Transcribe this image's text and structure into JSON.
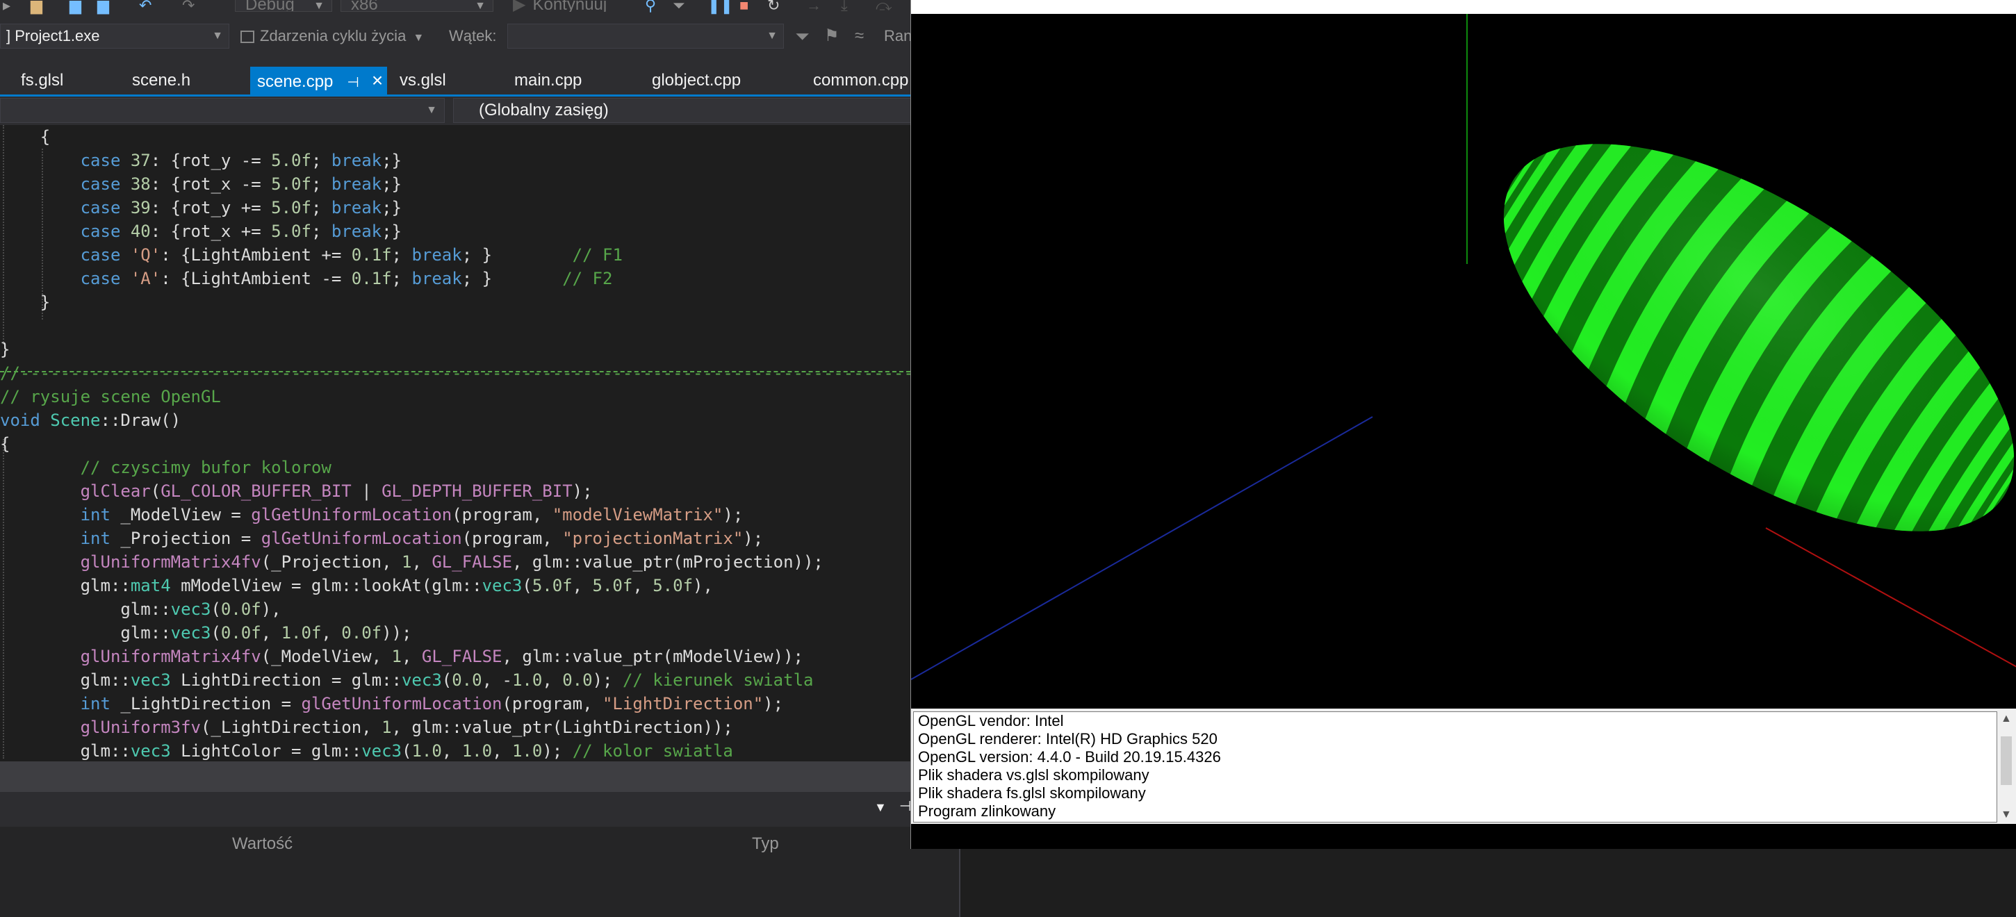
{
  "toolbar": {
    "configuration": "Debug",
    "platform": "x86",
    "continue_label": "Kontynuuj",
    "process": "] Project1.exe",
    "lifecycle_events": "Zdarzenia cyklu życia",
    "thread_label": "Wątek:",
    "thread_value": "",
    "ran_label": "Ran"
  },
  "tabs": [
    {
      "label": "fs.glsl"
    },
    {
      "label": "scene.h"
    },
    {
      "label": "scene.cpp",
      "active": true
    },
    {
      "label": "vs.glsl"
    },
    {
      "label": "main.cpp"
    },
    {
      "label": "globject.cpp"
    },
    {
      "label": "common.cpp"
    }
  ],
  "navbar": {
    "scope": "(Globalny zasięg)"
  },
  "code_lines": [
    "    {",
    "        case 37: {rot_y -= 5.0f; break;}",
    "        case 38: {rot_x -= 5.0f; break;}",
    "        case 39: {rot_y += 5.0f; break;}",
    "        case 40: {rot_x += 5.0f; break;}",
    "        case 'Q': {LightAmbient += 0.1f; break; }        // F1",
    "        case 'A': {LightAmbient -= 0.1f; break; }       // F2",
    "    }",
    "",
    "}",
    "//---------------------------------------------------------------------------------------------",
    "// rysuje scene OpenGL",
    "void Scene::Draw()",
    "{",
    "        // czyscimy bufor kolorow",
    "        glClear(GL_COLOR_BUFFER_BIT | GL_DEPTH_BUFFER_BIT);",
    "        int _ModelView = glGetUniformLocation(program, \"modelViewMatrix\");",
    "        int _Projection = glGetUniformLocation(program, \"projectionMatrix\");",
    "        glUniformMatrix4fv(_Projection, 1, GL_FALSE, glm::value_ptr(mProjection));",
    "        glm::mat4 mModelView = glm::lookAt(glm::vec3(5.0f, 5.0f, 5.0f),",
    "            glm::vec3(0.0f),",
    "            glm::vec3(0.0f, 1.0f, 0.0f));",
    "        glUniformMatrix4fv(_ModelView, 1, GL_FALSE, glm::value_ptr(mModelView));",
    "        glm::vec3 LightDirection = glm::vec3(0.0, -1.0, 0.0); // kierunek swiatla",
    "        int _LightDirection = glGetUniformLocation(program, \"LightDirection\");",
    "        glUniform3fv(_LightDirection, 1, glm::value_ptr(LightDirection));",
    "        glm::vec3 LightColor = glm::vec3(1.0, 1.0, 1.0); // kolor swiatla"
  ],
  "watch": {
    "col_value": "Wartość",
    "col_type": "Typ"
  },
  "gl_log": [
    "OpenGL vendor: Intel",
    "OpenGL renderer: Intel(R) HD Graphics 520",
    "OpenGL version: 4.4.0 - Build 20.19.15.4326",
    "Plik shadera vs.glsl skompilowany",
    "Plik shadera fs.glsl skompilowany",
    "Program zlinkowany"
  ],
  "colors": {
    "accent": "#007acc",
    "ellipsoid_light": "#22ee22",
    "ellipsoid_dark": "#0a7a0a"
  }
}
